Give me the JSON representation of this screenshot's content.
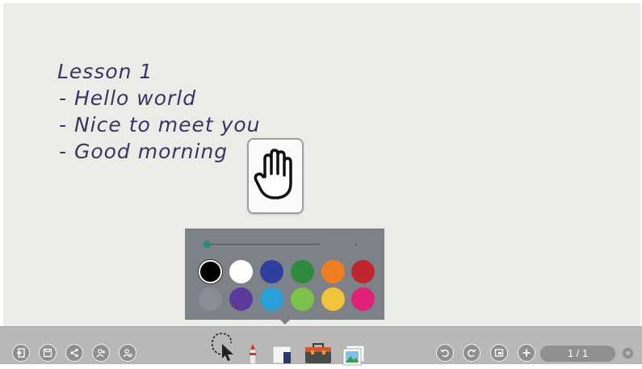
{
  "board": {
    "lines": [
      "Lesson 1",
      "- Hello world",
      "- Nice to meet you",
      "- Good morning"
    ]
  },
  "palette": {
    "selected_color": "#000000",
    "colors_row1": [
      "#000000",
      "#ffffff",
      "#2e3fa0",
      "#2e8b3d",
      "#ef7d22",
      "#c0262e"
    ],
    "colors_row2": [
      "#8a8e92",
      "#5b3a9a",
      "#2a9fd8",
      "#7cc24a",
      "#f2c23a",
      "#e0217a"
    ]
  },
  "toolbar": {
    "left_icons": [
      "exit-icon",
      "save-icon",
      "share-icon",
      "add-user-icon",
      "user-settings-icon"
    ],
    "tools": [
      "select-lasso-icon",
      "pen-icon",
      "eraser-icon",
      "toolbox-icon",
      "image-icon"
    ],
    "right_icons": [
      "undo-icon",
      "redo-icon",
      "fullscreen-icon",
      "add-page-icon"
    ],
    "page_indicator": "1 / 1",
    "settings_icon": "gear-icon"
  }
}
